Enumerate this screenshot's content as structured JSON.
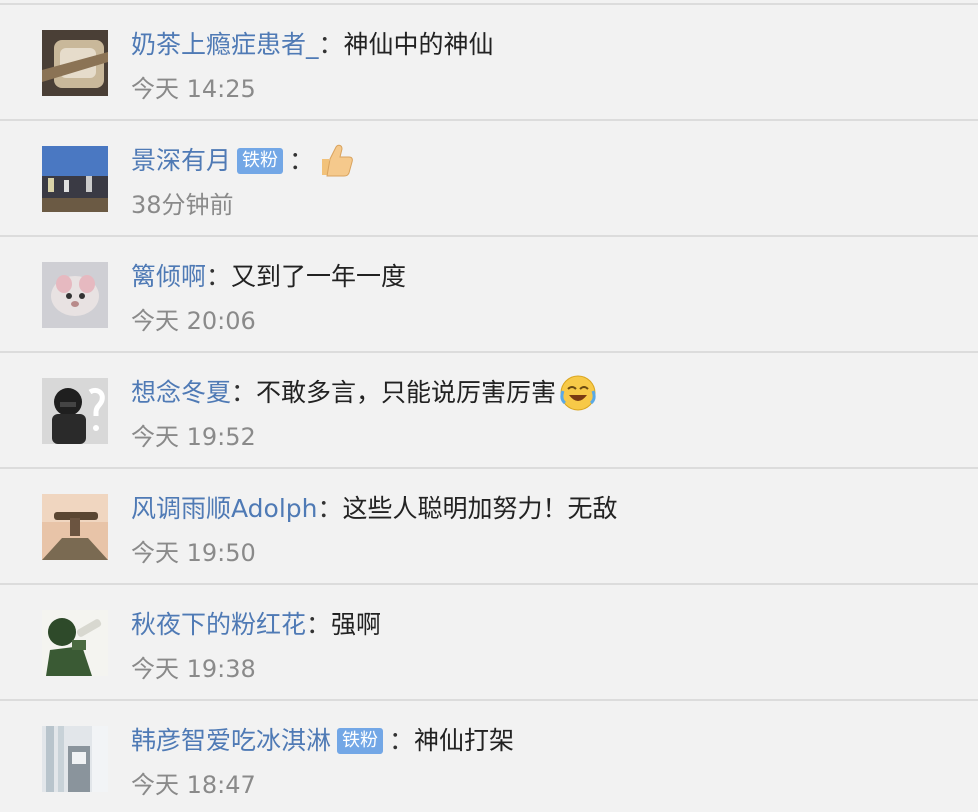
{
  "colors": {
    "username": "#4f7ab5",
    "time": "#8a8a8a",
    "badge_bg": "#73a7e6",
    "background": "#f2f2f2"
  },
  "comments": [
    {
      "username": "奶茶上瘾症患者_",
      "badge": "",
      "colon": "：",
      "text": "神仙中的神仙",
      "emoji": "",
      "time": "今天 14:25"
    },
    {
      "username": "景深有月",
      "badge": "铁粉",
      "colon": "：",
      "text": "",
      "emoji": "thumbs-up-emoji",
      "time": "38分钟前"
    },
    {
      "username": "篱倾啊",
      "badge": "",
      "colon": "：",
      "text": "又到了一年一度",
      "emoji": "",
      "time": "今天 20:06"
    },
    {
      "username": "想念冬夏",
      "badge": "",
      "colon": "：",
      "text": "不敢多言，只能说厉害厉害",
      "emoji": "laughing-crying-emoji",
      "time": "今天 19:52"
    },
    {
      "username": "风调雨顺Adolph",
      "badge": "",
      "colon": "：",
      "text": "这些人聪明加努力！无敌",
      "emoji": "",
      "time": "今天 19:50"
    },
    {
      "username": "秋夜下的粉红花",
      "badge": "",
      "colon": "：",
      "text": "强啊",
      "emoji": "",
      "time": "今天 19:38"
    },
    {
      "username": "韩彦智爱吃冰淇淋",
      "badge": "铁粉",
      "colon": "：",
      "text": "神仙打架",
      "emoji": "",
      "time": "今天 18:47"
    }
  ]
}
